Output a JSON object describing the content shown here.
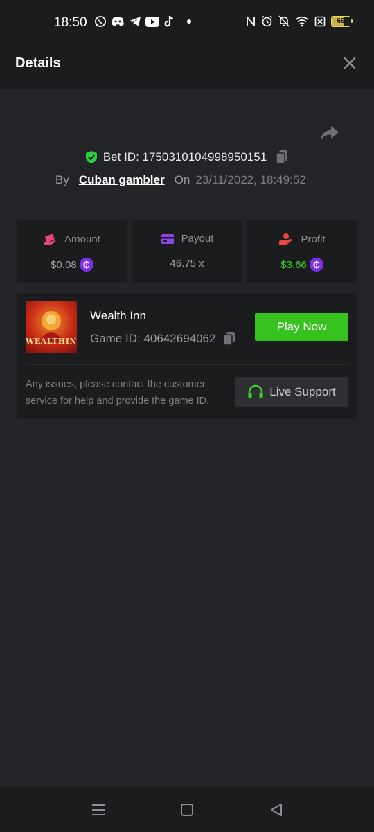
{
  "status_bar": {
    "time": "18:50",
    "battery": "69",
    "app_icons": [
      "whatsapp-icon",
      "discord-icon",
      "telegram-icon",
      "youtube-icon",
      "tiktok-icon"
    ]
  },
  "header": {
    "title": "Details"
  },
  "bet": {
    "id_label": "Bet ID: 1750310104998950151",
    "by_label": "By",
    "user": "Cuban gambler",
    "on_label": "On",
    "date": "23/11/2022, 18:49:52"
  },
  "stats": {
    "amount_label": "Amount",
    "amount_value": "$0.08",
    "payout_label": "Payout",
    "payout_value": "46.75 x",
    "profit_label": "Profit",
    "profit_value": "$3.66",
    "currency_symbol": "₵"
  },
  "game": {
    "thumb_text": "WEALTHINN",
    "name": "Wealth Inn",
    "id_label": "Game ID: 40642694062",
    "play_label": "Play Now",
    "help_text": "Any issues, please contact the customer service for help and provide the game ID.",
    "support_label": "Live Support"
  },
  "colors": {
    "accent_green": "#36c21f",
    "profit_green": "#3ad12a",
    "coin_purple": "#7d2ee8",
    "shield_green": "#2ecc40",
    "amount_pink": "#e8457a",
    "payout_purple": "#8b45e8",
    "profit_red": "#e84545"
  }
}
